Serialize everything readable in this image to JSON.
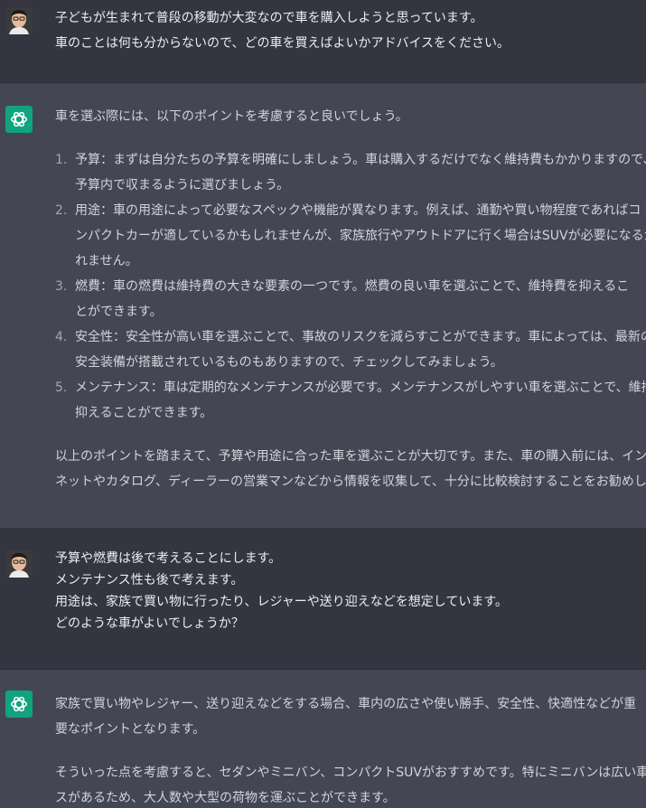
{
  "conversation": {
    "m1": {
      "lines": [
        "子どもが生まれて普段の移動が大変なので車を購入しようと思っています。",
        "車のことは何も分からないので、どの車を買えばよいかアドバイスをください。"
      ]
    },
    "m2": {
      "intro": "車を選ぶ際には、以下のポイントを考慮すると良いでしょう。",
      "items": [
        {
          "num": "1.",
          "lines": [
            "予算：まずは自分たちの予算を明確にしましょう。車は購入するだけでなく維持費もかかりますので、",
            "予算内で収まるように選びましょう。"
          ]
        },
        {
          "num": "2.",
          "lines": [
            "用途：車の用途によって必要なスペックや機能が異なります。例えば、通勤や買い物程度であればコ",
            "ンパクトカーが適しているかもしれませんが、家族旅行やアウトドアに行く場合はSUVが必要になるかもし",
            "れません。"
          ]
        },
        {
          "num": "3.",
          "lines": [
            "燃費：車の燃費は維持費の大きな要素の一つです。燃費の良い車を選ぶことで、維持費を抑えるこ",
            "とができます。"
          ]
        },
        {
          "num": "4.",
          "lines": [
            "安全性：安全性が高い車を選ぶことで、事故のリスクを減らすことができます。車によっては、最新の",
            "安全装備が搭載されているものもありますので、チェックしてみましょう。"
          ]
        },
        {
          "num": "5.",
          "lines": [
            "メンテナンス：車は定期的なメンテナンスが必要です。メンテナンスがしやすい車を選ぶことで、維持費を",
            "抑えることができます。"
          ]
        }
      ],
      "outro": [
        "以上のポイントを踏まえて、予算や用途に合った車を選ぶことが大切です。また、車の購入前には、インター",
        "ネットやカタログ、ディーラーの営業マンなどから情報を収集して、十分に比較検討することをお勧めします。"
      ]
    },
    "m3": {
      "lines": [
        "予算や燃費は後で考えることにします。",
        "メンテナンス性も後で考えます。",
        "用途は、家族で買い物に行ったり、レジャーや送り迎えなどを想定しています。",
        "どのような車がよいでしょうか？"
      ]
    },
    "m4": {
      "p1": [
        "家族で買い物やレジャー、送り迎えなどをする場合、車内の広さや使い勝手、安全性、快適性などが重",
        "要なポイントとなります。"
      ],
      "p2": [
        "そういった点を考慮すると、セダンやミニバン、コンパクトSUVがおすすめです。特にミニバンは広い車内スペー",
        "スがあるため、大人数や大型の荷物を運ぶことができます。"
      ]
    }
  },
  "icons": {
    "user_avatar": "user-photo-icon",
    "assistant_avatar": "chatgpt-logo-icon"
  },
  "colors": {
    "user_bg": "#343541",
    "assistant_bg": "#444654",
    "logo_bg": "#10a37f"
  }
}
